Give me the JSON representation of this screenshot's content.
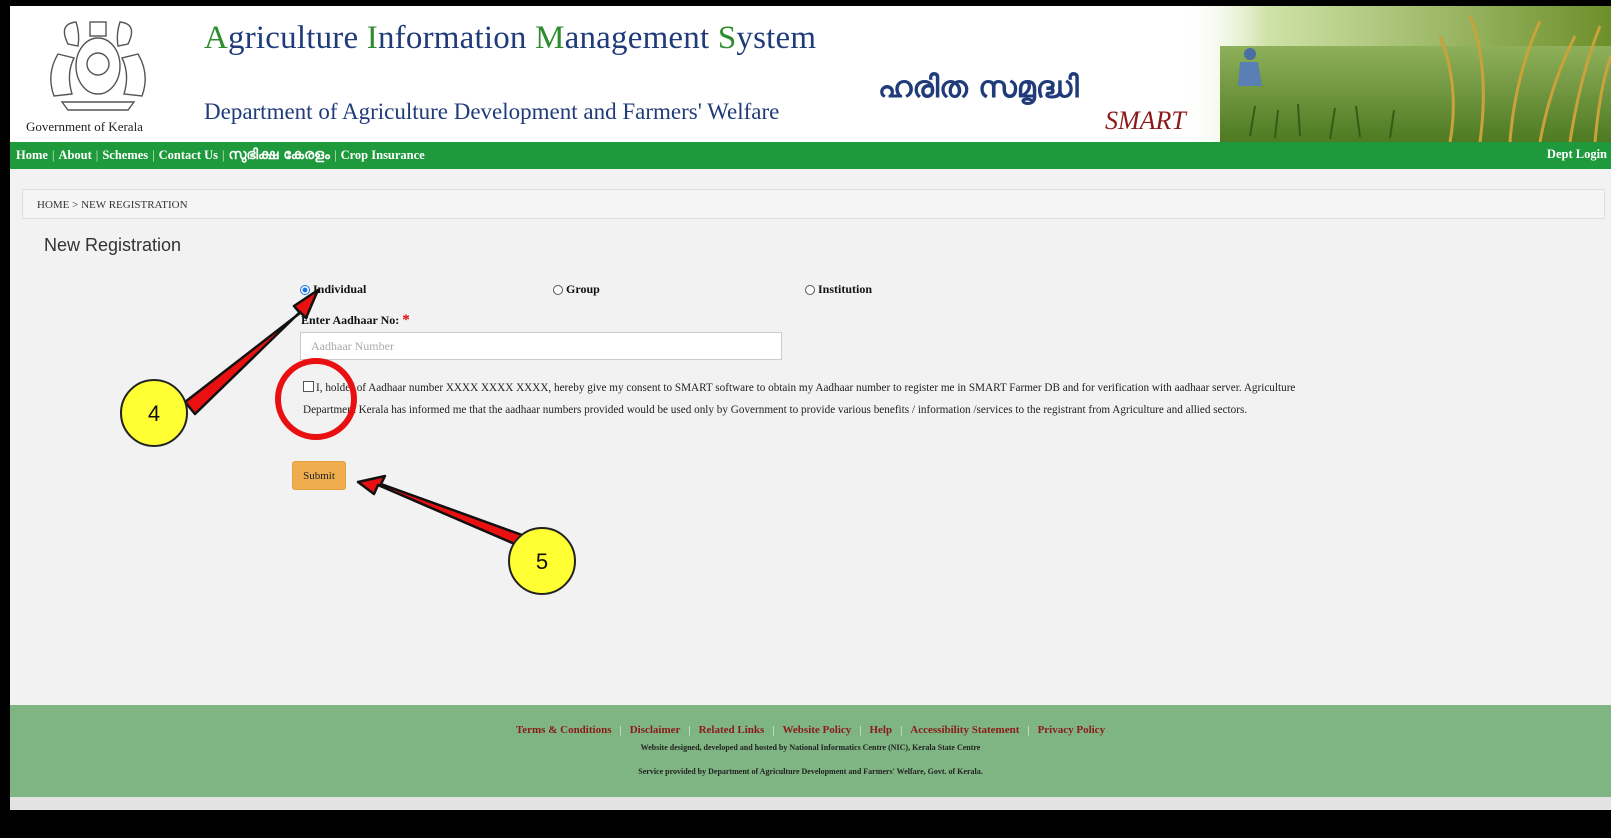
{
  "header": {
    "emblem_caption": "Government of Kerala",
    "app_title": {
      "p1_cap": "A",
      "p1": "griculture ",
      "p2_cap": "I",
      "p2": "nformation ",
      "p3_cap": "M",
      "p3": "anagement ",
      "p4_cap": "S",
      "p4": "ystem"
    },
    "department": "Department of Agriculture Development and Farmers' Welfare",
    "brand_malayalam": "ഹരിത സമൃദ്ധി",
    "brand_smart": "SMART"
  },
  "nav": {
    "items": [
      "Home",
      "About",
      "Schemes",
      "Contact Us",
      "സുഭിക്ഷ കേരളം",
      "Crop Insurance"
    ],
    "right_link": "Dept Login"
  },
  "breadcrumb": "HOME > NEW REGISTRATION",
  "page_title": "New Registration",
  "form": {
    "registration_types": [
      {
        "label": "Individual",
        "selected": true
      },
      {
        "label": "Group",
        "selected": false
      },
      {
        "label": "Institution",
        "selected": false
      }
    ],
    "aadhaar_label": "Enter Aadhaar No:",
    "required_mark": "*",
    "aadhaar_placeholder": "Aadhaar Number",
    "aadhaar_value": "",
    "consent_checked": false,
    "consent_text": "I, holder of Aadhaar number XXXX XXXX XXXX, hereby give my consent to SMART software to obtain my Aadhaar number to register me in SMART Farmer DB and for verification with aadhaar server. Agriculture Department Kerala has informed me that the aadhaar numbers provided would be used only by Government to provide various benefits / information /services to the registrant from Agriculture and allied sectors.",
    "submit_label": "Submit"
  },
  "footer": {
    "links": [
      "Terms & Conditions",
      "Disclaimer",
      "Related Links",
      "Website Policy",
      "Help",
      "Accessibility Statement",
      "Privacy Policy"
    ],
    "nic_credit": "Website designed, developed and hosted by National Informatics Centre (NIC), Kerala State Centre",
    "service_credit": "Service provided by Department of Agriculture Development and Farmers' Welfare, Govt. of Kerala."
  },
  "annotations": {
    "step_4": "4",
    "step_5": "5",
    "highlight_color": "#e81010",
    "badge_color": "#ffff33"
  },
  "colors": {
    "nav_green": "#1e9a3c",
    "title_blue": "#1f3b7a",
    "title_green": "#2e8b2e",
    "submit_orange": "#f0ad4e",
    "footer_green": "#7fb582",
    "footer_link": "#8b1a1a"
  }
}
